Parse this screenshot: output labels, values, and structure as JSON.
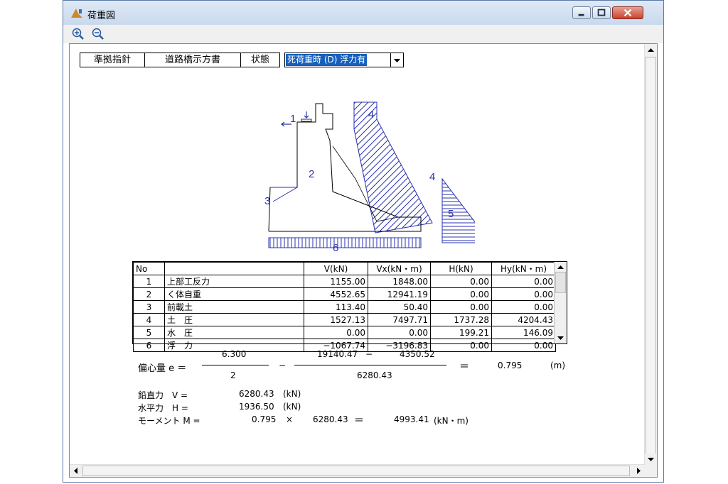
{
  "window": {
    "title": "荷重図"
  },
  "standards": {
    "label": "準拠指針",
    "value": "道路橋示方書",
    "state_label": "状態",
    "state_selected": "死荷重時 (D) 浮力有"
  },
  "diagram": {
    "labels": [
      "1",
      "2",
      "3",
      "4",
      "4",
      "5",
      "6"
    ]
  },
  "table": {
    "headers": [
      "No",
      "",
      "V(kN)",
      "Vx(kN・m)",
      "H(kN)",
      "Hy(kN・m)"
    ],
    "rows": [
      {
        "no": "1",
        "name": "上部工反力",
        "v": "1155.00",
        "vx": "1848.00",
        "h": "0.00",
        "hy": "0.00"
      },
      {
        "no": "2",
        "name": "く体自重",
        "v": "4552.65",
        "vx": "12941.19",
        "h": "0.00",
        "hy": "0.00"
      },
      {
        "no": "3",
        "name": "前載土",
        "v": "113.40",
        "vx": "50.40",
        "h": "0.00",
        "hy": "0.00"
      },
      {
        "no": "4",
        "name": "土　圧",
        "v": "1527.13",
        "vx": "7497.71",
        "h": "1737.28",
        "hy": "4204.43"
      },
      {
        "no": "5",
        "name": "水　圧",
        "v": "0.00",
        "vx": "0.00",
        "h": "199.21",
        "hy": "146.09"
      },
      {
        "no": "6",
        "name": "浮　力",
        "v": "−1067.74",
        "vx": "−3196.83",
        "h": "0.00",
        "hy": "0.00"
      }
    ]
  },
  "calc": {
    "ecc_label": "偏心量 e ＝",
    "frac1_num": "6.300",
    "frac1_den": "2",
    "minus": "−",
    "frac2_num_a": "19140.47",
    "frac2_minus": "−",
    "frac2_num_b": "4350.52",
    "frac2_den": "6280.43",
    "equals": "＝",
    "ecc_value": "0.795",
    "ecc_unit": "(m)",
    "v_label": "鉛直力　V =",
    "v_value": "6280.43",
    "v_unit": "(kN)",
    "h_label": "水平力　H =",
    "h_value": "1936.50",
    "h_unit": "(kN)",
    "m_label": "モーメント M =",
    "m_e": "0.795",
    "m_times": "×",
    "m_v": "6280.43",
    "m_equals": "＝",
    "m_value": "4993.41",
    "m_unit": "(kN・m)"
  }
}
